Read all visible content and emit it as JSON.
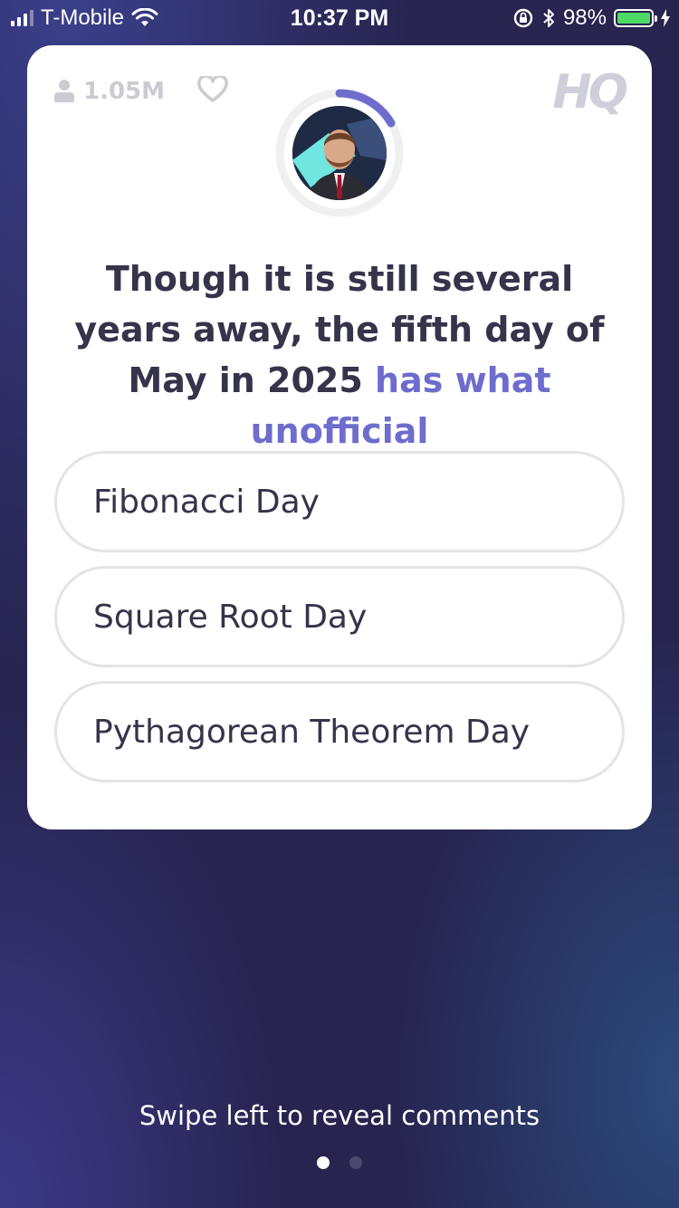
{
  "status_bar": {
    "carrier": "T-Mobile",
    "time": "10:37 PM",
    "battery": "98%"
  },
  "card": {
    "viewer_count": "1.05M",
    "logo": "HQ",
    "question": {
      "main_text": "Though it is still several years away, the fifth day of May in 2025",
      "highlight_text": "has what unofficial"
    },
    "answers": [
      {
        "label": "Fibonacci Day"
      },
      {
        "label": "Square Root Day"
      },
      {
        "label": "Pythagorean Theorem Day"
      }
    ]
  },
  "footer": {
    "swipe_hint": "Swipe left to reveal comments"
  },
  "colors": {
    "accent": "#6e6ccd",
    "background": "#27244f",
    "battery": "#4cd964"
  },
  "icons": [
    "signal-icon",
    "wifi-icon",
    "rotation-lock-icon",
    "bluetooth-icon",
    "battery-icon",
    "person-icon",
    "heart-icon"
  ]
}
